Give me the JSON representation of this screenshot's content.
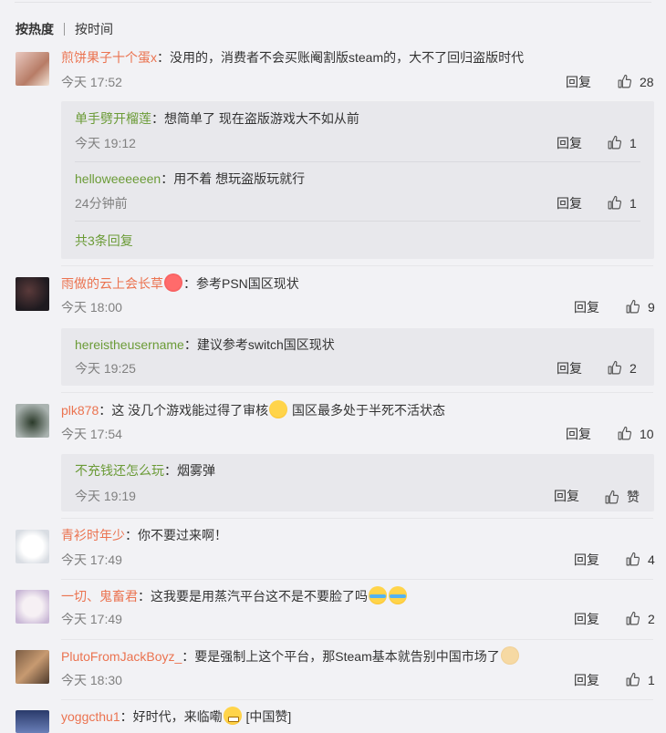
{
  "tabs": {
    "hot": "按热度",
    "time": "按时间"
  },
  "actions": {
    "reply": "回复"
  },
  "comments": [
    {
      "user": "煎饼果子十个蛋x",
      "text": "：没用的，消费者不会买账阉割版steam的，大不了回归盗版时代",
      "time": "今天 17:52",
      "likes": "28",
      "subs": [
        {
          "user": "单手劈开榴莲",
          "text": "：想简单了 现在盗版游戏大不如从前",
          "time": "今天 19:12",
          "likes": "1"
        },
        {
          "user": "helloweeeeeen",
          "text": "：用不着 想玩盗版玩就行",
          "time": "24分钟前",
          "likes": "1"
        }
      ],
      "more": "共3条回复"
    },
    {
      "user": "雨做的云上会长草",
      "text": "：参考PSN国区现状",
      "time": "今天 18:00",
      "likes": "9",
      "subs": [
        {
          "user": "hereistheusername",
          "text": "：建议参考switch国区现状",
          "time": "今天 19:25",
          "likes": "2"
        }
      ]
    },
    {
      "user": "plk878",
      "text_a": "：这 没几个游戏能过得了审核",
      "text_b": " 国区最多处于半死不活状态",
      "time": "今天 17:54",
      "likes": "10",
      "subs": [
        {
          "user": "不充钱还怎么玩",
          "text": "：烟雾弹",
          "time": "今天 19:19",
          "likes": "赞"
        }
      ]
    },
    {
      "user": "青衫时年少",
      "text": "：你不要过来啊！",
      "time": "今天 17:49",
      "likes": "4"
    },
    {
      "user": "一切、鬼畜君",
      "text": "：这我要是用蒸汽平台这不是不要脸了吗",
      "time": "今天 17:49",
      "likes": "2"
    },
    {
      "user": "PlutoFromJackBoyz_",
      "text": "：要是强制上这个平台，那Steam基本就告别中国市场了",
      "time": "今天 18:30",
      "likes": "1"
    },
    {
      "user": "yoggcthu1",
      "text": "：好时代，来临嘞",
      "tag": "[中国赞]"
    }
  ],
  "colors": {
    "username": "#eb7350",
    "sub_username": "#6b9b37",
    "background": "#f2f2f5",
    "sub_background": "#e8e8ec"
  }
}
